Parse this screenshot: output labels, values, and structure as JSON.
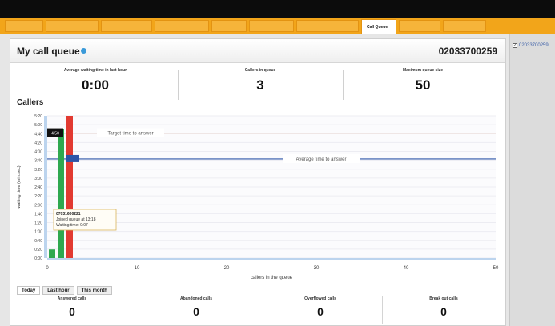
{
  "topbar": {
    "account_text": ""
  },
  "tabs": [
    {
      "label": ""
    },
    {
      "label": ""
    },
    {
      "label": ""
    },
    {
      "label": ""
    },
    {
      "label": ""
    },
    {
      "label": ""
    },
    {
      "label": ""
    },
    {
      "label": "Call Queue"
    },
    {
      "label": ""
    },
    {
      "label": ""
    }
  ],
  "right_panel": {
    "phone_number": "02033700259",
    "checked": true
  },
  "panel": {
    "title": "My call queue",
    "refresh_text": "",
    "phone_number": "02033700259",
    "stats": [
      {
        "label": "Average waiting time in last hour",
        "value": "0:00"
      },
      {
        "label": "Callers in queue",
        "value": "3"
      },
      {
        "label": "Maximum queue size",
        "value": "50"
      }
    ]
  },
  "colors": {
    "orange": "#f2a51a",
    "target_line": "#e6a27a",
    "average_line": "#2d55a8",
    "bar_green": "#2fa84f",
    "bar_red": "#e23a31"
  },
  "chart_data": {
    "type": "bar",
    "title": "Callers",
    "xlabel": "callers in the queue",
    "ylabel": "waiting time (min:sec)",
    "xlim": [
      0,
      50
    ],
    "x_ticks": [
      "0",
      "10",
      "20",
      "30",
      "40",
      "50"
    ],
    "ylim": [
      0,
      330
    ],
    "y_ticks": [
      "0:00",
      "0:20",
      "0:40",
      "1:00",
      "1:20",
      "1:40",
      "2:00",
      "2:20",
      "2:40",
      "3:00",
      "3:20",
      "3:40",
      "4:00",
      "4:20",
      "4:40",
      "5:00",
      "5:20"
    ],
    "series": [
      {
        "x": 0,
        "value": 20,
        "color": "#2fa84f"
      },
      {
        "x": 1,
        "value": 300,
        "color": "#2fa84f"
      },
      {
        "x": 2,
        "value": 330,
        "color": "#e23a31"
      }
    ],
    "target_line": {
      "label": "Target time to answer",
      "value": 290
    },
    "average_line": {
      "label": "Average time to answer",
      "value": 230
    },
    "markers": [
      {
        "label": "4:50",
        "value": 290
      },
      {
        "label": "",
        "value": 230
      }
    ],
    "tooltip": {
      "line1": "07031600221",
      "line2": "Joined queue at 13:18",
      "line3": "Waiting time: 0:07"
    }
  },
  "range_tabs": [
    {
      "label": "Today"
    },
    {
      "label": "Last hour"
    },
    {
      "label": "This month"
    }
  ],
  "footer": [
    {
      "label": "Answered calls",
      "value": "0"
    },
    {
      "label": "Abandoned calls",
      "value": "0"
    },
    {
      "label": "Overflowed calls",
      "value": "0"
    },
    {
      "label": "Break out calls",
      "value": "0"
    }
  ]
}
